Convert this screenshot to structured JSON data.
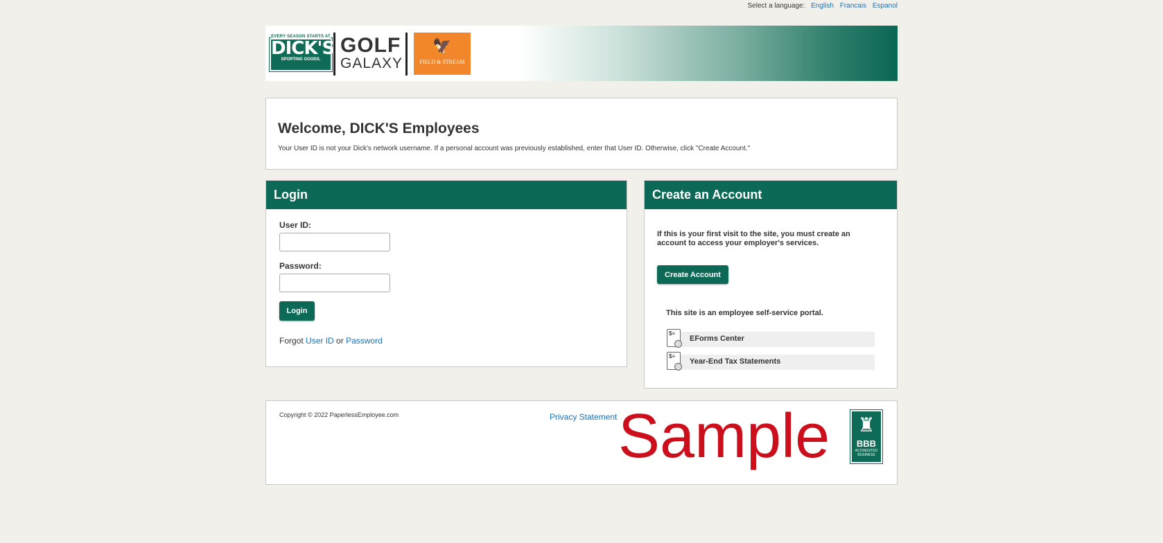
{
  "language_bar": {
    "label": "Select a language:",
    "options": [
      "English",
      "Francais",
      "Espanol"
    ]
  },
  "banner": {
    "dicks_logo": {
      "tagline": "EVERY SEASON STARTS AT",
      "name": "DICK'S",
      "subtitle": "SPORTING GOODS."
    },
    "golf_logo": {
      "line1": "GOLF",
      "line2": "GALAXY"
    },
    "field_stream_logo": {
      "name": "FIELD & STREAM"
    }
  },
  "welcome": {
    "title": "Welcome, DICK'S Employees",
    "message": "Your User ID is not your Dick's network username. If a personal account was previously established, enter that User ID. Otherwise, click \"Create Account.\""
  },
  "login": {
    "heading": "Login",
    "user_id_label": "User ID:",
    "user_id_value": "",
    "password_label": "Password:",
    "password_value": "",
    "button": "Login",
    "forgot_prefix": "Forgot",
    "forgot_user_id": "User ID",
    "forgot_or": "or",
    "forgot_password": "Password"
  },
  "create_account": {
    "heading": "Create an Account",
    "intro": "If this is your first visit to the site, you must create an account to access your employer's services.",
    "button": "Create Account",
    "portal_note": "This site is an employee self-service portal.",
    "items": [
      {
        "label": "EForms Center",
        "icon": "document-icon"
      },
      {
        "label": "Year-End Tax Statements",
        "icon": "document-icon"
      }
    ]
  },
  "footer": {
    "copyright": "Copyright © 2022 PaperlessEmployee.com",
    "privacy": "Privacy Statement",
    "watermark": "Sample",
    "bbb": {
      "text": "BBB",
      "subtitle": "ACCREDITED BUSINESS"
    }
  },
  "colors": {
    "brand_green": "#0b6955",
    "link_blue": "#1f6fb2",
    "watermark_red": "#cc0f1c",
    "page_bg": "#f2f0eb"
  }
}
